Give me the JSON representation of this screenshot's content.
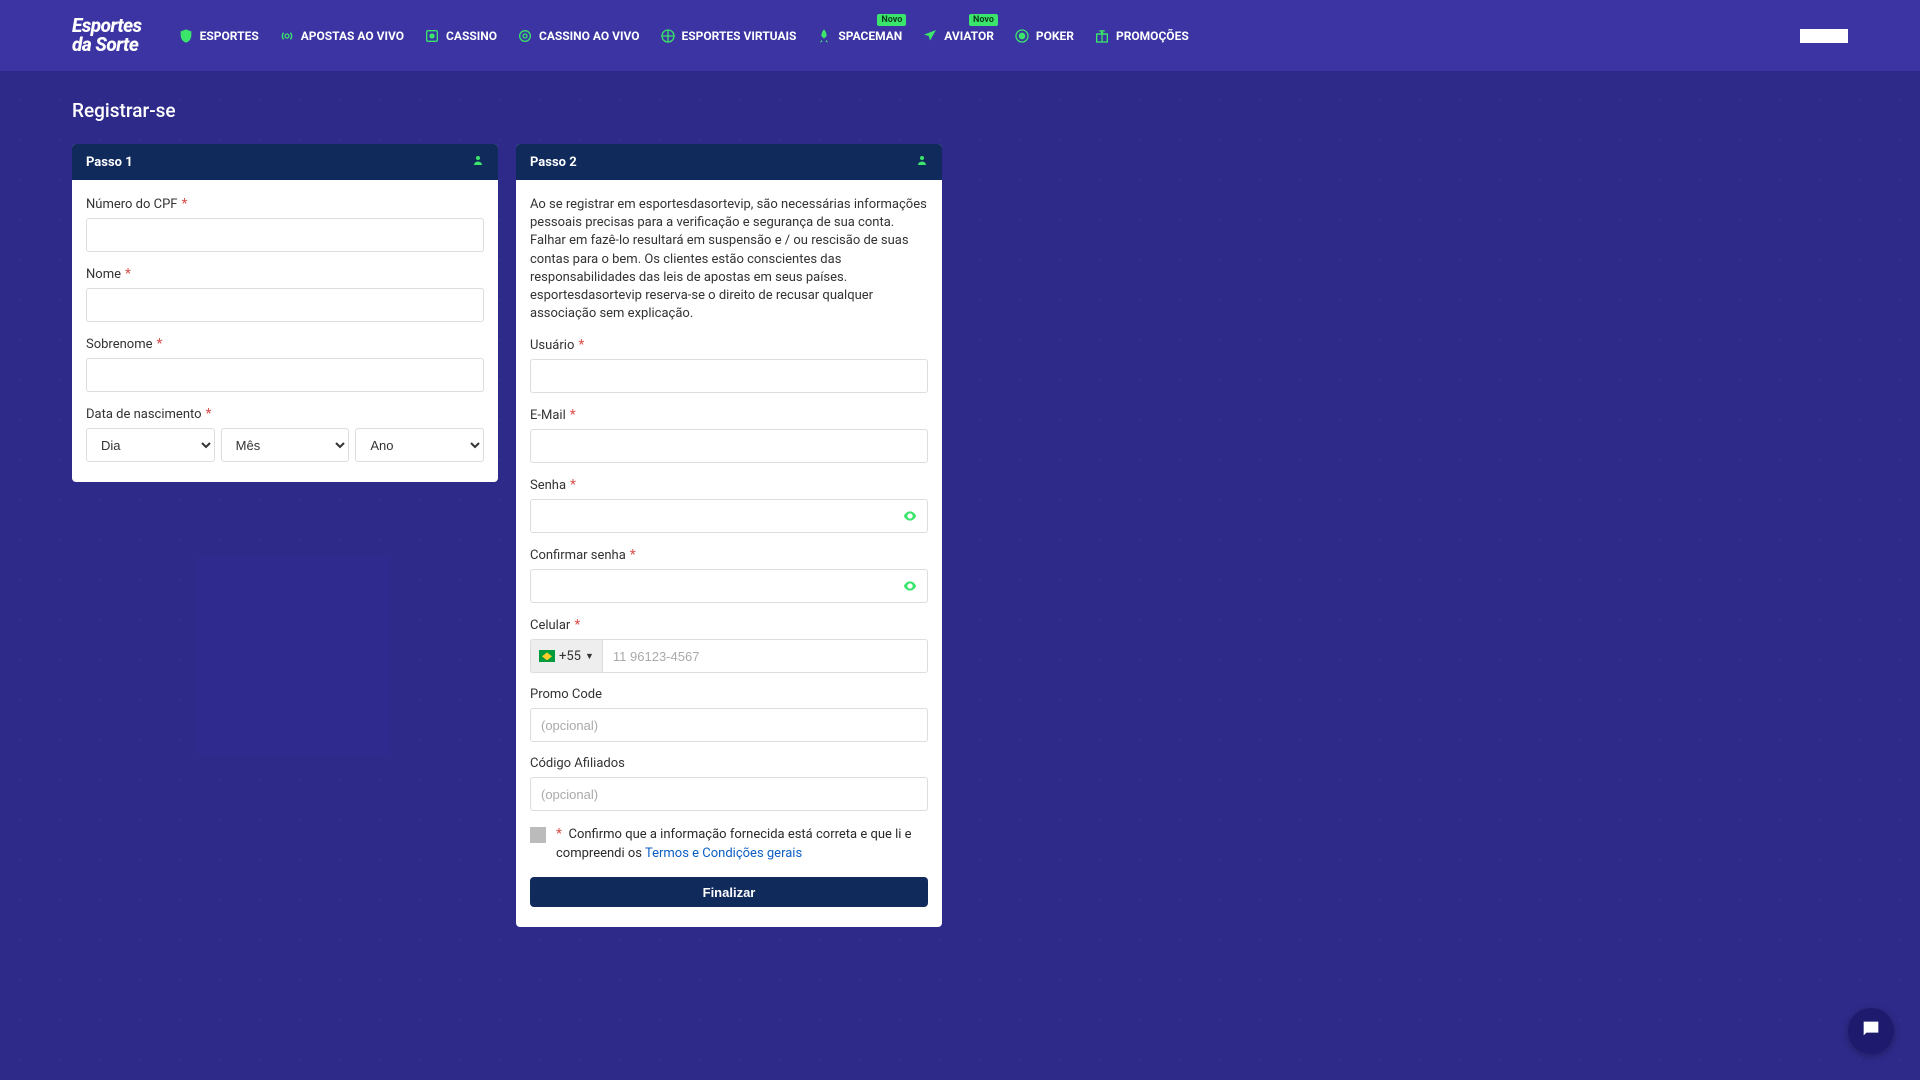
{
  "header": {
    "brand_line1": "Esportes",
    "brand_line2": "da Sorte",
    "nav": [
      {
        "id": "esportes",
        "label": "ESPORTES"
      },
      {
        "id": "apostas-ao-vivo",
        "label": "APOSTAS AO VIVO"
      },
      {
        "id": "cassino",
        "label": "CASSINO"
      },
      {
        "id": "cassino-ao-vivo",
        "label": "CASSINO AO VIVO"
      },
      {
        "id": "esportes-virtuais",
        "label": "ESPORTES VIRTUAIS"
      },
      {
        "id": "spaceman",
        "label": "SPACEMAN",
        "badge": "Novo"
      },
      {
        "id": "aviator",
        "label": "AVIATOR",
        "badge": "Novo"
      },
      {
        "id": "poker",
        "label": "POKER"
      },
      {
        "id": "promocoes",
        "label": "PROMOÇÕES"
      }
    ]
  },
  "page": {
    "title": "Registrar-se"
  },
  "step1": {
    "title": "Passo 1",
    "cpf_label": "Número do CPF",
    "nome_label": "Nome",
    "sobrenome_label": "Sobrenome",
    "dob_label": "Data de nascimento",
    "dob_day": "Dia",
    "dob_month": "Mês",
    "dob_year": "Ano"
  },
  "step2": {
    "title": "Passo 2",
    "info": "Ao se registrar em esportesdasortevip, são necessárias informações pessoais precisas para a verificação e segurança de sua conta. Falhar em fazê-lo resultará em suspensão e / ou rescisão de suas contas para o bem. Os clientes estão conscientes das responsabilidades das leis de apostas em seus países. esportesdasortevip reserva-se o direito de recusar qualquer associação sem explicação.",
    "usuario_label": "Usuário",
    "email_label": "E-Mail",
    "senha_label": "Senha",
    "confirmar_label": "Confirmar senha",
    "celular_label": "Celular",
    "celular_prefix": "+55",
    "celular_placeholder": "11 96123-4567",
    "promo_label": "Promo Code",
    "promo_placeholder": "(opcional)",
    "afiliados_label": "Código Afiliados",
    "afiliados_placeholder": "(opcional)",
    "terms_text_1": "Confirmo que a informação fornecida está correta e que li e compreendi os ",
    "terms_link": "Termos e Condições gerais",
    "submit": "Finalizar"
  }
}
